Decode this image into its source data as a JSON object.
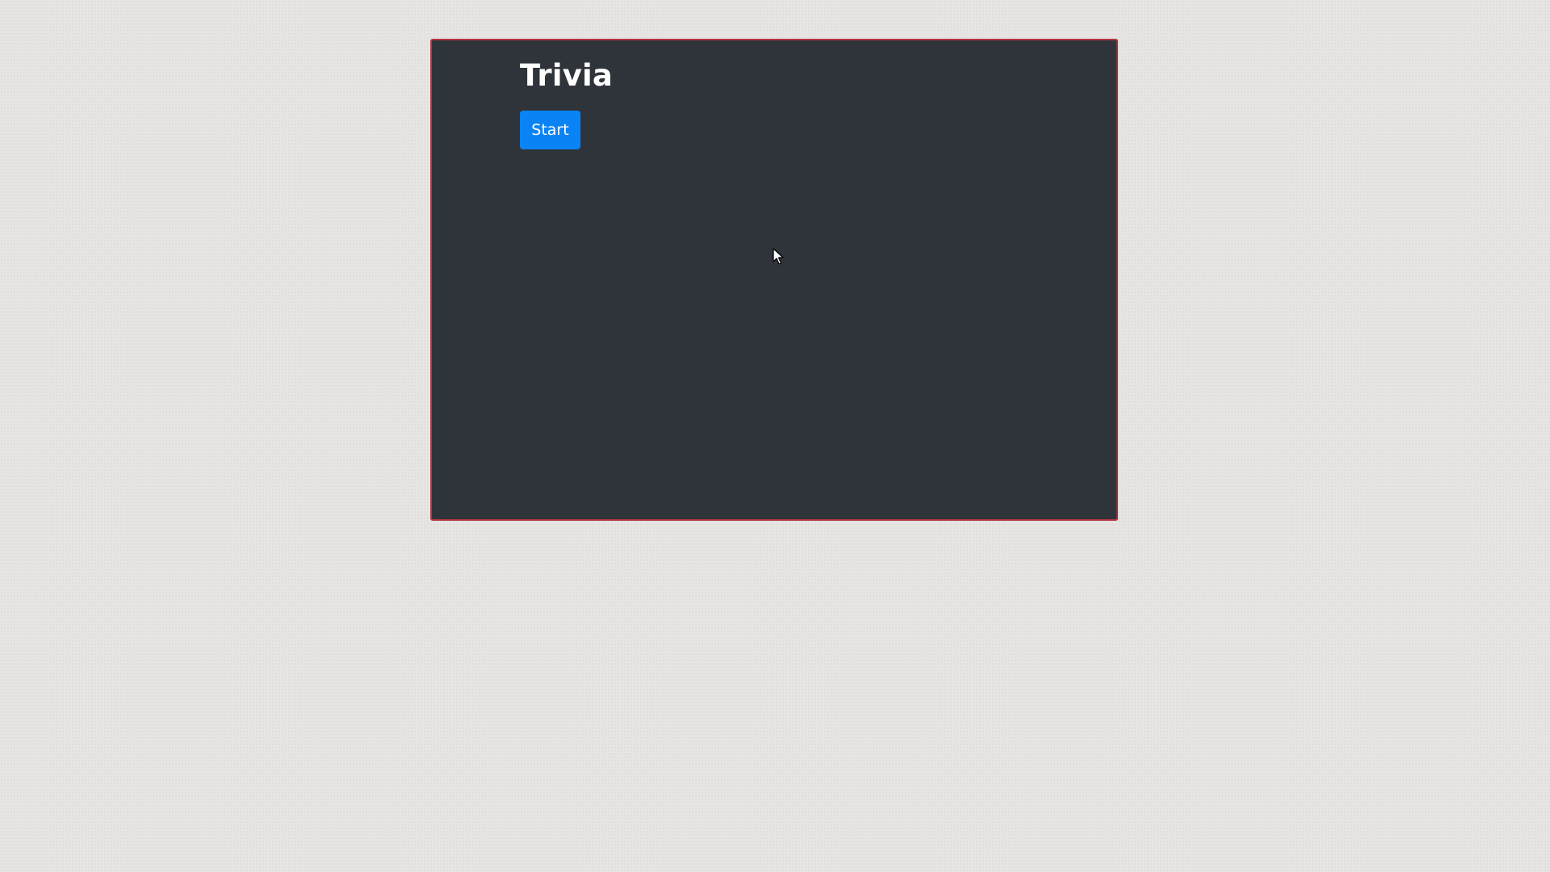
{
  "game": {
    "title": "Trivia",
    "start_label": "Start"
  },
  "colors": {
    "page_background": "#e6e5e4",
    "panel_background": "#2f343a",
    "panel_border": "#b3353f",
    "button_primary": "#0a84f5",
    "text": "#ffffff"
  },
  "icons": {
    "cursor": "mouse-pointer-icon"
  }
}
